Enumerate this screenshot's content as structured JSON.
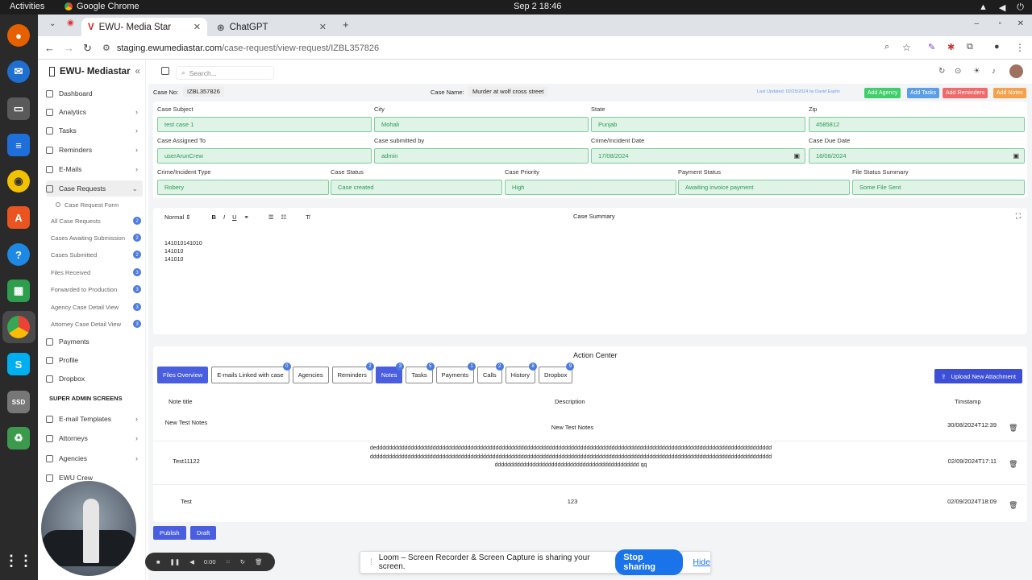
{
  "os": {
    "activities": "Activities",
    "app": "Google Chrome",
    "clock": "Sep 2  18:46"
  },
  "browser": {
    "tabs": [
      {
        "label": "EWU- Media Star"
      },
      {
        "label": "ChatGPT"
      }
    ],
    "url_host": "staging.ewumediastar.com",
    "url_path": "/case-request/view-request/IZBL357826"
  },
  "sidebar": {
    "brand": "EWU- Mediastar",
    "items": [
      {
        "label": "Dashboard"
      },
      {
        "label": "Analytics"
      },
      {
        "label": "Tasks"
      },
      {
        "label": "Reminders"
      },
      {
        "label": "E-Mails"
      },
      {
        "label": "Case Requests"
      }
    ],
    "sub_form": "Case Request Form",
    "subs": [
      {
        "label": "All Case Requests",
        "count": "2"
      },
      {
        "label": "Cases Awaiting Submission",
        "count": "2"
      },
      {
        "label": "Cases Submitted",
        "count": "2"
      },
      {
        "label": "Files Received",
        "count": "3"
      },
      {
        "label": "Forwarded to Production",
        "count": "3"
      },
      {
        "label": "Agency Case Detail View",
        "count": "3"
      },
      {
        "label": "Attorney Case Detail View",
        "count": "3"
      }
    ],
    "items2": [
      {
        "label": "Payments"
      },
      {
        "label": "Profile"
      },
      {
        "label": "Dropbox"
      }
    ],
    "section": "SUPER ADMIN SCREENS",
    "admin": [
      {
        "label": "E-mail Templates"
      },
      {
        "label": "Attorneys"
      },
      {
        "label": "Agencies"
      },
      {
        "label": "EWU Crew"
      }
    ]
  },
  "header": {
    "search_placeholder": "Search..."
  },
  "case": {
    "no_label": "Case No:",
    "no": "IZBL357826",
    "name_label": "Case Name:",
    "name": "Murder at wolf cross street",
    "updated": "Last Updated: 02/25/2024 by David Esplin",
    "buttons": [
      {
        "label": "Add Agency",
        "color": "#3fce6a"
      },
      {
        "label": "Add Tasks",
        "color": "#5b9ee8"
      },
      {
        "label": "Add Reminders",
        "color": "#f06a6a"
      },
      {
        "label": "Add Notes",
        "color": "#f5a04a"
      }
    ]
  },
  "form": {
    "row1": [
      {
        "label": "Case Subject",
        "value": "test case 1"
      },
      {
        "label": "City",
        "value": "Mohali"
      },
      {
        "label": "State",
        "value": "Punjab"
      },
      {
        "label": "Zip",
        "value": "4585812"
      }
    ],
    "row2": [
      {
        "label": "Case Assigned To",
        "value": "userArunCrew"
      },
      {
        "label": "Case submitted by",
        "value": "admin"
      },
      {
        "label": "Crime/Incident Date",
        "value": "17/08/2024"
      },
      {
        "label": "Case Due Date",
        "value": "18/08/2024"
      }
    ],
    "row3": [
      {
        "label": "Crime/Incident Type",
        "value": "Robery"
      },
      {
        "label": "Case Status",
        "value": "Case created"
      },
      {
        "label": "Case Priority",
        "value": "High"
      },
      {
        "label": "Payment Status",
        "value": "Awaiting invoice payment"
      },
      {
        "label": "File Status Summary",
        "value": "Some File Sent"
      }
    ]
  },
  "editor": {
    "format": "Normal",
    "title": "Case Summary",
    "lines": [
      "141010141010",
      "141010",
      "141010"
    ]
  },
  "action_center": {
    "title": "Action Center",
    "tabs": [
      {
        "label": "Files Overview",
        "badge": ""
      },
      {
        "label": "E-mails Linked with case",
        "badge": "0"
      },
      {
        "label": "Agencies",
        "badge": ""
      },
      {
        "label": "Reminders",
        "badge": "2"
      },
      {
        "label": "Notes",
        "badge": "3"
      },
      {
        "label": "Tasks",
        "badge": "5"
      },
      {
        "label": "Payments",
        "badge": "1"
      },
      {
        "label": "Calls",
        "badge": "2"
      },
      {
        "label": "History",
        "badge": "8"
      },
      {
        "label": "Dropbox",
        "badge": "9"
      }
    ],
    "upload": "Upload New Attachment",
    "headers": {
      "title": "Note title",
      "desc": "Description",
      "time": "Timstamp"
    },
    "rows": [
      {
        "title": "New Test Notes",
        "desc": "New Test Notes",
        "time": "30/08/2024T12:39"
      },
      {
        "title": "Test11122",
        "desc": "dedddddddddddddddddddddddddddddddddddddddddddddddddddddddddddddddddddddddddddddddddddddddddddddddddddddddddddddddddddddddddddddddddddddddddddddddddddddddddddddddddddddddddddddddddddddddddddddddddddddddddddddddddddddddddddddddddddddddddddddddddddddddddddddddddddddddddddddddddddddddddddddddddddddddddddd qq",
        "time": "02/09/2024T17:11"
      },
      {
        "title": "Test",
        "desc": "123",
        "time": "02/09/2024T18:09"
      }
    ]
  },
  "footer": {
    "publish": "Publish",
    "draft": "Draft"
  },
  "recorder": {
    "time": "0:00"
  },
  "loom": {
    "text": "Loom – Screen Recorder & Screen Capture is sharing your screen.",
    "stop": "Stop sharing",
    "hide": "Hide"
  }
}
